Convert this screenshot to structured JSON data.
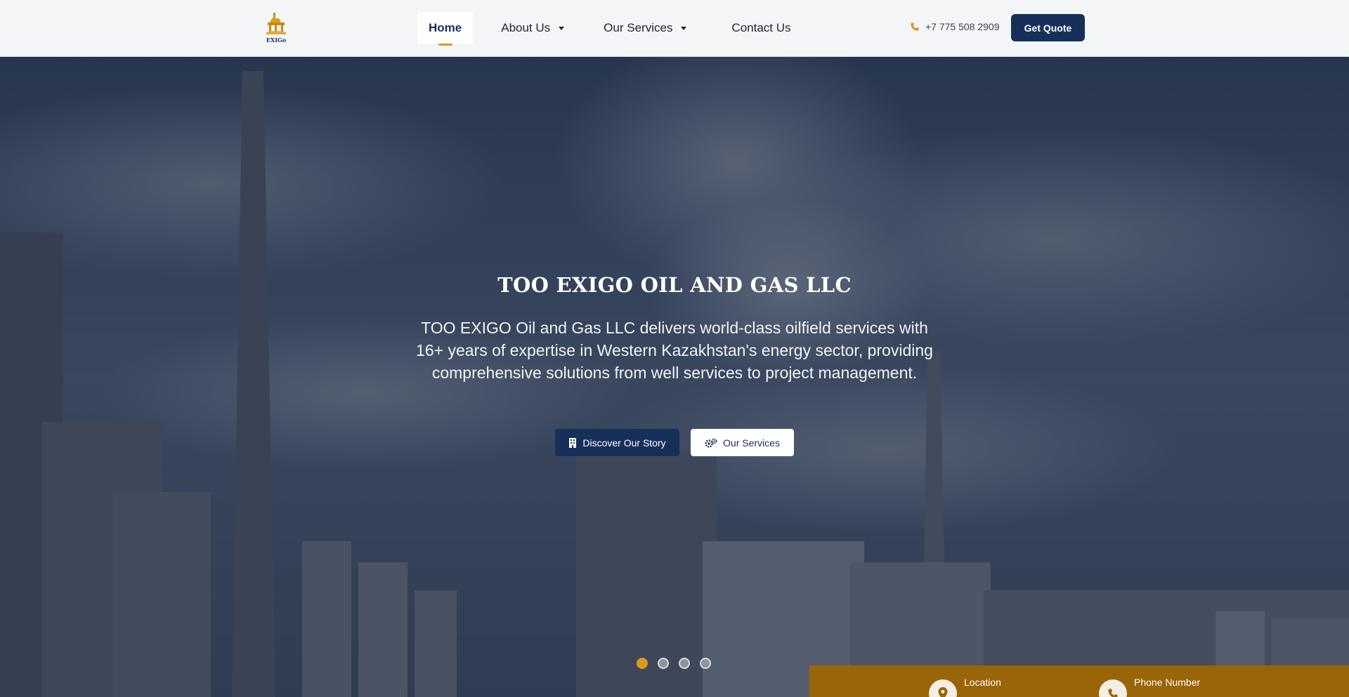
{
  "header": {
    "logo_alt": "EXIGO logo",
    "nav": [
      {
        "label": "Home",
        "active": true,
        "dropdown": false
      },
      {
        "label": "About Us",
        "active": false,
        "dropdown": true
      },
      {
        "label": "Our Services",
        "active": false,
        "dropdown": true
      },
      {
        "label": "Contact Us",
        "active": false,
        "dropdown": false
      }
    ],
    "phone": "+7 775 508 2909",
    "quote_button": "Get Quote"
  },
  "hero": {
    "title": "TOO EXIGO OIL AND GAS LLC",
    "text": "TOO EXIGO Oil and Gas LLC delivers world-class oilfield services with 16+ years of expertise in Western Kazakhstan's energy sector, providing comprehensive solutions from well services to project management.",
    "primary_button": "Discover Our Story",
    "secondary_button": "Our Services",
    "slides": 4,
    "active_slide": 1
  },
  "info_bar": {
    "items": [
      {
        "label": "Location",
        "icon": "map-pin-icon"
      },
      {
        "label": "Phone Number",
        "icon": "phone-icon"
      }
    ]
  },
  "colors": {
    "brand_navy": "#17305a",
    "accent_gold": "#d99a1f",
    "info_bar": "#9a6508"
  }
}
